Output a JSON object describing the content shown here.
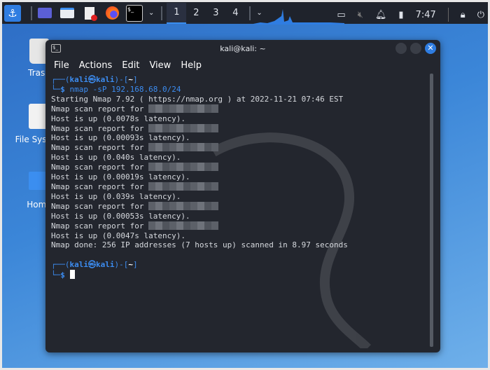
{
  "taskbar": {
    "workspaces": [
      "1",
      "2",
      "3",
      "4"
    ],
    "active_workspace": "1",
    "clock": "7:47"
  },
  "desktop": {
    "icons": [
      {
        "label": "Trash"
      },
      {
        "label": "File System"
      },
      {
        "label": "Home"
      }
    ]
  },
  "window": {
    "title": "kali@kali: ~",
    "menu": [
      "File",
      "Actions",
      "Edit",
      "View",
      "Help"
    ]
  },
  "terminal": {
    "prompt_user": "kali",
    "prompt_host": "kali",
    "prompt_dir": "~",
    "command": "nmap -sP 192.168.68.0/24",
    "start": "Starting Nmap 7.92 ( https://nmap.org ) at 2022-11-21 07:46 EST",
    "report_prefix": "Nmap scan report for ",
    "hosts": [
      "Host is up (0.0078s latency).",
      "Host is up (0.00093s latency).",
      "Host is up (0.040s latency).",
      "Host is up (0.00019s latency).",
      "Host is up (0.039s latency).",
      "Host is up (0.00053s latency).",
      "Host is up (0.0047s latency)."
    ],
    "done": "Nmap done: 256 IP addresses (7 hosts up) scanned in 8.97 seconds"
  }
}
